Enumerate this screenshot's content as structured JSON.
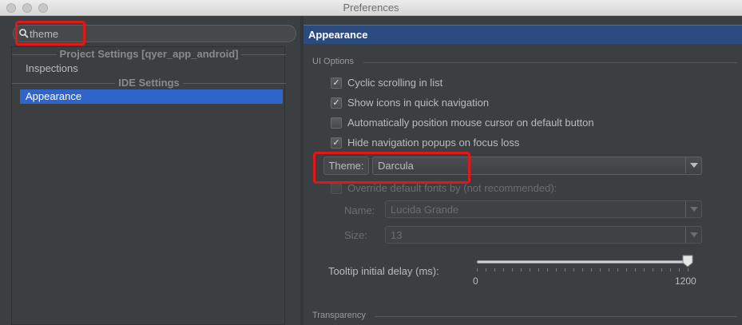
{
  "window": {
    "title": "Preferences"
  },
  "search": {
    "value": "theme"
  },
  "tree": {
    "groups": [
      {
        "header": "Project Settings [qyer_app_android]",
        "items": [
          "Inspections"
        ]
      },
      {
        "header": "IDE Settings",
        "items": [
          "Appearance"
        ]
      }
    ],
    "selected": "Appearance"
  },
  "panel": {
    "title": "Appearance",
    "ui_options": {
      "section_title": "UI Options",
      "checkboxes": [
        {
          "label": "Cyclic scrolling in list",
          "checked": true
        },
        {
          "label": "Show icons in quick navigation",
          "checked": true
        },
        {
          "label": "Automatically position mouse cursor on default button",
          "checked": false
        },
        {
          "label": "Hide navigation popups on focus loss",
          "checked": true
        }
      ],
      "theme_label": "Theme:",
      "theme_value": "Darcula",
      "override_fonts": {
        "label": "Override default fonts by (not recommended):",
        "checked": false,
        "enabled": false
      },
      "name_label": "Name:",
      "name_value": "Lucida Grande",
      "size_label": "Size:",
      "size_value": "13",
      "tooltip_label": "Tooltip initial delay (ms):",
      "tooltip_min": "0",
      "tooltip_max": "1200",
      "tooltip_fraction": 1.0
    },
    "transparency": {
      "section_title": "Transparency"
    }
  },
  "colors": {
    "background": "#3c3f41",
    "selection": "#2f65ca",
    "header": "#2b4b7e",
    "highlight": "#e3171a"
  }
}
